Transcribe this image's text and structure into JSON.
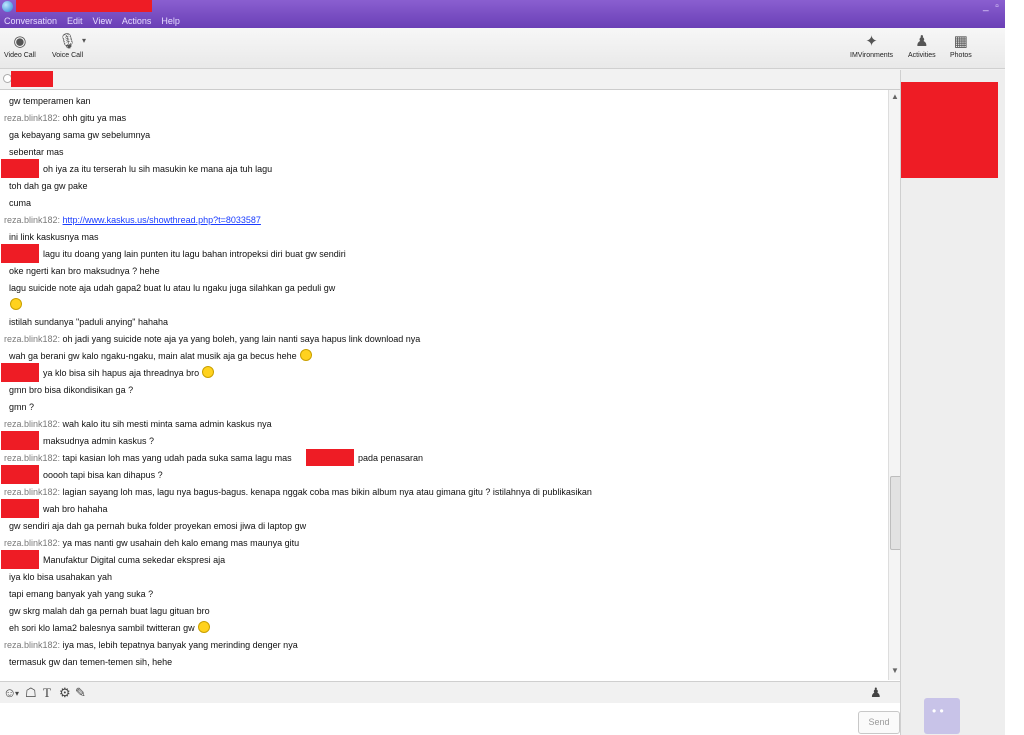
{
  "menu": [
    "Conversation",
    "Edit",
    "View",
    "Actions",
    "Help"
  ],
  "window_controls": "_ ▫ ✕",
  "toolbar": {
    "video_call": "Video Call",
    "voice_call": "Voice Call",
    "imvironments": "IMVironments",
    "activities": "Activities",
    "photos": "Photos"
  },
  "messages": [
    {
      "sender": "",
      "text": "gw temperamen kan"
    },
    {
      "sender": "reza.blink182: ",
      "text": "ohh gitu ya mas"
    },
    {
      "sender": "",
      "text": "ga kebayang sama gw sebelumnya"
    },
    {
      "sender": "",
      "text": "sebentar mas"
    },
    {
      "sender": "",
      "text": "oh iya za itu terserah lu sih masukin ke mana aja tuh lagu"
    },
    {
      "sender": "",
      "text": "toh dah ga gw pake"
    },
    {
      "sender": "",
      "text": "cuma"
    },
    {
      "sender": "reza.blink182: ",
      "link": "http://www.kaskus.us/showthread.php?t=8033587"
    },
    {
      "sender": "",
      "text": "ini link kaskusnya mas"
    },
    {
      "sender": "",
      "text": "lagu itu doang yang lain punten itu lagu bahan intropeksi diri buat gw sendiri"
    },
    {
      "sender": "",
      "text": "oke ngerti kan bro maksudnya ? hehe"
    },
    {
      "sender": "",
      "text": "lagu suicide note aja udah gapa2 buat lu atau lu ngaku juga silahkan ga peduli gw"
    },
    {
      "sender": "",
      "text": ""
    },
    {
      "sender": "",
      "text": "istilah sundanya \"paduli anying\" hahaha"
    },
    {
      "sender": "reza.blink182: ",
      "text": "oh jadi yang suicide note aja ya yang boleh, yang lain nanti saya hapus link download nya"
    },
    {
      "sender": "",
      "text": "wah ga berani gw kalo ngaku-ngaku, main alat musik aja ga becus hehe"
    },
    {
      "sender": "",
      "text": "ya klo bisa sih hapus aja threadnya bro"
    },
    {
      "sender": "",
      "text": "gmn bro bisa dikondisikan ga ?"
    },
    {
      "sender": "",
      "text": "gmn ?"
    },
    {
      "sender": "reza.blink182: ",
      "text": "wah kalo itu sih mesti minta sama admin kaskus nya"
    },
    {
      "sender": "",
      "text": "maksudnya admin kaskus ?"
    },
    {
      "sender": "reza.blink182: ",
      "text": "tapi kasian loh mas yang udah pada suka sama lagu mas",
      "text2": "pada penasaran"
    },
    {
      "sender": "",
      "text": "ooooh tapi bisa kan dihapus ?"
    },
    {
      "sender": "reza.blink182: ",
      "text": "lagian sayang loh mas, lagu nya bagus-bagus. kenapa nggak coba mas bikin album nya atau gimana gitu ? istilahnya di publikasikan"
    },
    {
      "sender": "",
      "text": "wah bro hahaha"
    },
    {
      "sender": "",
      "text": "gw sendiri aja dah ga pernah buka folder proyekan emosi jiwa di laptop gw"
    },
    {
      "sender": "reza.blink182: ",
      "text": "ya mas nanti gw usahain deh kalo emang mas maunya gitu"
    },
    {
      "sender": "",
      "text": "Manufaktur Digital cuma sekedar ekspresi aja"
    },
    {
      "sender": "",
      "text": "iya klo bisa usahakan yah"
    },
    {
      "sender": "",
      "text": "tapi emang banyak yah yang suka ?"
    },
    {
      "sender": "",
      "text": "gw skrg malah dah ga pernah buat lagu gituan bro"
    },
    {
      "sender": "",
      "text": "eh sori klo lama2 balesnya sambil twitteran gw"
    },
    {
      "sender": "reza.blink182: ",
      "text": "iya mas, lebih tepatnya banyak yang merinding denger nya"
    },
    {
      "sender": "",
      "text": "termasuk gw dan temen-temen sih, hehe"
    }
  ],
  "send_label": "Send",
  "colors": {
    "redaction": "#ee1c25",
    "sender": "#7a7a7a",
    "link": "#1a3cff"
  }
}
